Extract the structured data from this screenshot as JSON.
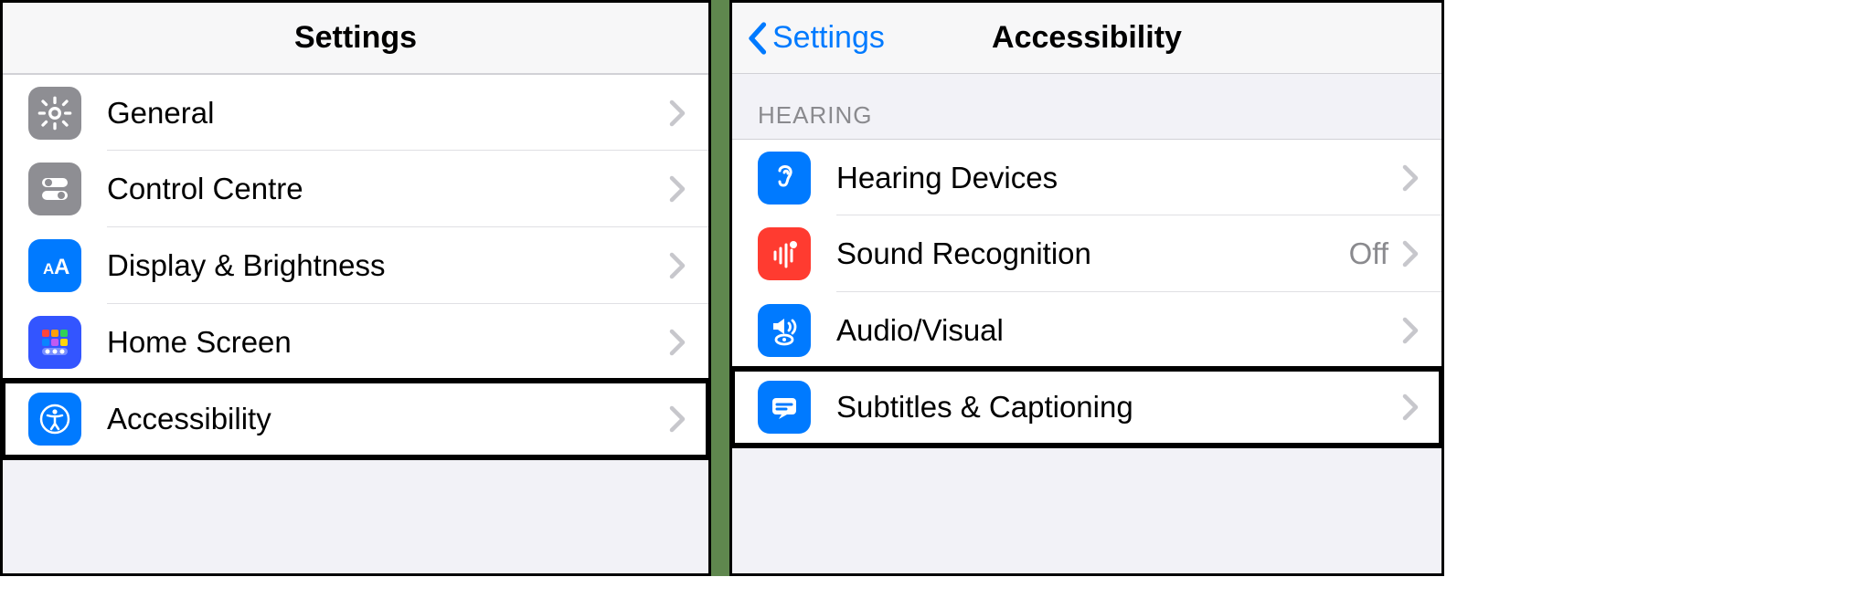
{
  "left": {
    "title": "Settings",
    "items": [
      {
        "label": "General"
      },
      {
        "label": "Control Centre"
      },
      {
        "label": "Display & Brightness"
      },
      {
        "label": "Home Screen"
      },
      {
        "label": "Accessibility"
      }
    ]
  },
  "right": {
    "back_label": "Settings",
    "title": "Accessibility",
    "section": "Hearing",
    "items": [
      {
        "label": "Hearing Devices",
        "value": ""
      },
      {
        "label": "Sound Recognition",
        "value": "Off"
      },
      {
        "label": "Audio/Visual",
        "value": ""
      },
      {
        "label": "Subtitles & Captioning",
        "value": ""
      }
    ]
  }
}
